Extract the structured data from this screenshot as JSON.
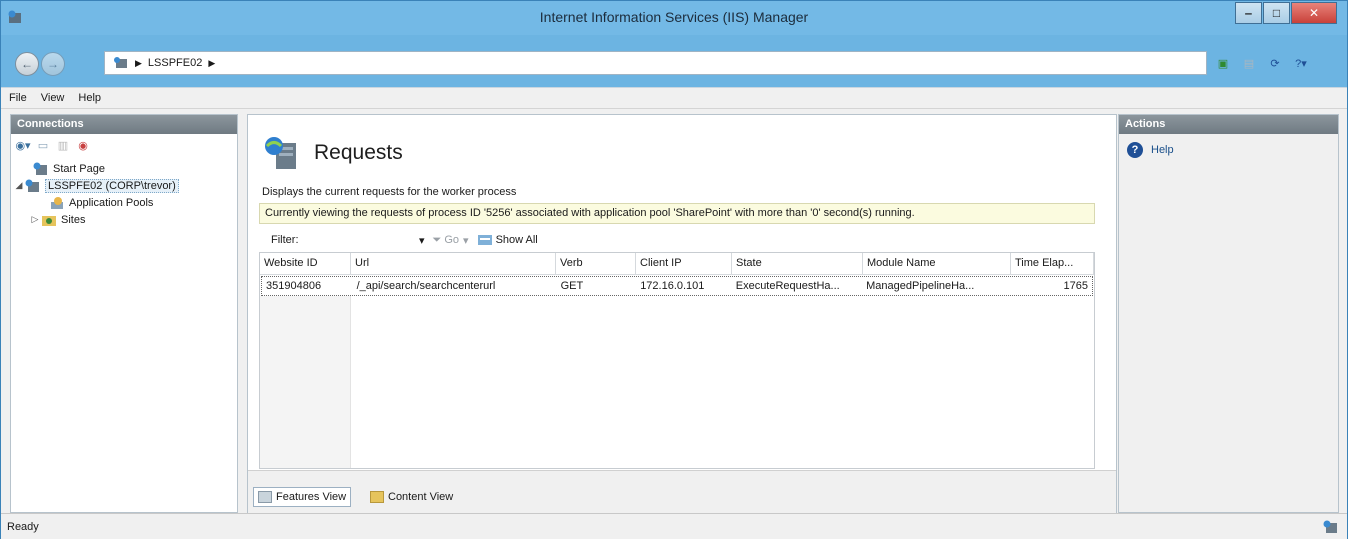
{
  "window": {
    "title": "Internet Information Services (IIS) Manager"
  },
  "address": {
    "crumbs": [
      "LSSPFE02"
    ]
  },
  "menu": [
    "File",
    "View",
    "Help"
  ],
  "connections": {
    "header": "Connections",
    "tree": {
      "start_page": "Start Page",
      "server": "LSSPFE02 (CORP\\trevor)",
      "app_pools": "Application Pools",
      "sites": "Sites"
    }
  },
  "content": {
    "title": "Requests",
    "description": "Displays the current requests for the worker process",
    "info": "Currently viewing the requests of process ID '5256' associated with application pool 'SharePoint' with more than '0' second(s) running.",
    "filter": {
      "label": "Filter:",
      "go": "Go",
      "show_all": "Show All"
    },
    "columns": [
      "Website ID",
      "Url",
      "Verb",
      "Client IP",
      "State",
      "Module Name",
      "Time Elap..."
    ],
    "rows": [
      [
        "351904806",
        "/_api/search/searchcenterurl",
        "GET",
        "172.16.0.101",
        "ExecuteRequestHa...",
        "ManagedPipelineHa...",
        "1765"
      ]
    ],
    "tabs": {
      "features": "Features View",
      "content": "Content View"
    }
  },
  "actions": {
    "header": "Actions",
    "help": "Help"
  },
  "status": {
    "text": "Ready"
  },
  "colors": {
    "titlebar": "#73b9e6",
    "close": "#c8413a",
    "panel_header": "#7a848b",
    "info_bg": "#fbfbdf"
  }
}
